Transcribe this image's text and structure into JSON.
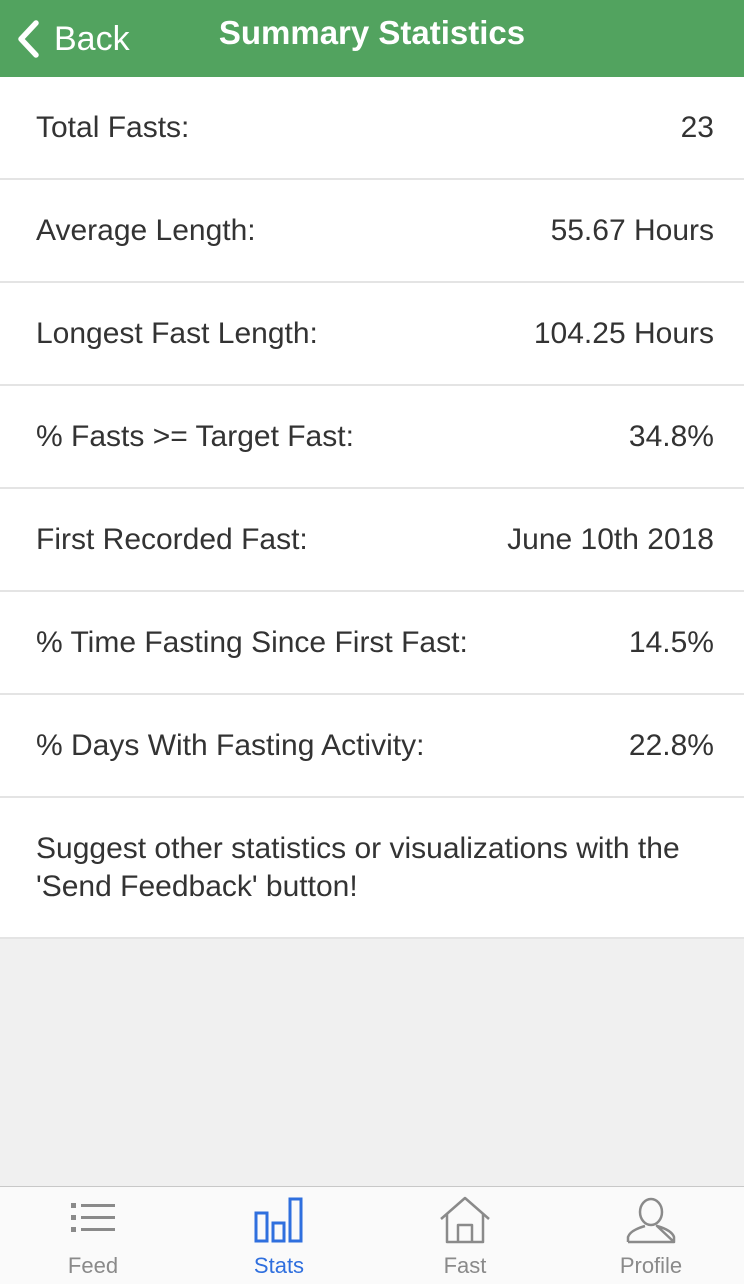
{
  "header": {
    "back_label": "Back",
    "title": "Summary Statistics"
  },
  "stats": [
    {
      "label": "Total Fasts:",
      "value": "23"
    },
    {
      "label": "Average Length:",
      "value": "55.67 Hours"
    },
    {
      "label": "Longest Fast Length:",
      "value": "104.25 Hours"
    },
    {
      "label": "% Fasts >= Target Fast:",
      "value": "34.8%"
    },
    {
      "label": "First Recorded Fast:",
      "value": "June 10th 2018"
    },
    {
      "label": "% Time Fasting Since First Fast:",
      "value": "14.5%"
    },
    {
      "label": "% Days With Fasting Activity:",
      "value": "22.8%"
    }
  ],
  "note": "Suggest other statistics or visualizations with the 'Send Feedback' button!",
  "tabbar": {
    "active": "Stats",
    "tabs": [
      {
        "label": "Feed",
        "icon": "list-icon"
      },
      {
        "label": "Stats",
        "icon": "bar-chart-icon"
      },
      {
        "label": "Fast",
        "icon": "home-icon"
      },
      {
        "label": "Profile",
        "icon": "person-icon"
      }
    ]
  },
  "colors": {
    "header_bg": "#52a35f",
    "active_tab": "#2f6fde",
    "inactive_tab": "#8a8a8a"
  }
}
